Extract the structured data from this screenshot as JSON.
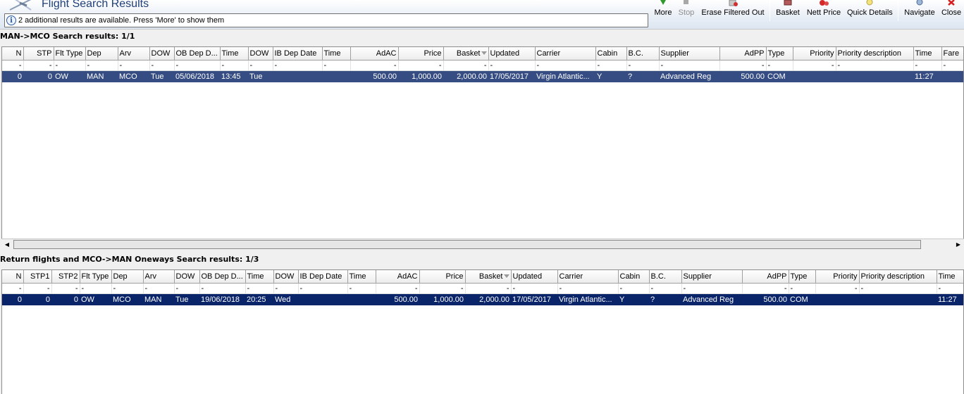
{
  "window": {
    "title": "Flight Search Results"
  },
  "info_bar": {
    "message": "2 additional results are available. Press 'More' to show them"
  },
  "toolbar": {
    "more": "More",
    "stop": "Stop",
    "erase_filtered_out": "Erase Filtered Out",
    "basket": "Basket",
    "nett_price": "Nett Price",
    "quick_details": "Quick Details",
    "navigate": "Navigate",
    "close": "Close"
  },
  "outbound": {
    "title": "MAN->MCO Search results: 1/1",
    "columns": [
      "N",
      "STP",
      "Flt Type",
      "Dep",
      "Arv",
      "DOW",
      "OB Dep D...",
      "Time",
      "DOW",
      "IB Dep Date",
      "Time",
      "AdAC",
      "Price",
      "Basket",
      "Updated",
      "Carrier",
      "Cabin",
      "B.C.",
      "Supplier",
      "AdPP",
      "Type",
      "Priority",
      "Priority description",
      "Time",
      "Fare"
    ],
    "filter_row": [
      "-",
      "-",
      "-",
      "-",
      "-",
      "-",
      "-",
      "-",
      "-",
      "-",
      "-",
      "-",
      "-",
      "-",
      "-",
      "-",
      "-",
      "-",
      "-",
      "-",
      "-",
      "-",
      "-",
      "-",
      "-"
    ],
    "rows": [
      [
        "0",
        "0",
        "OW",
        "MAN",
        "MCO",
        "Tue",
        "05/06/2018",
        "13:45",
        "Tue",
        "",
        "",
        "500.00",
        "1,000.00",
        "2,000.00",
        "17/05/2017",
        "Virgin Atlantic...",
        "Y",
        "?",
        "Advanced Reg",
        "500.00",
        "COM",
        "",
        "",
        "11:27",
        ""
      ]
    ]
  },
  "return": {
    "title": "Return flights and MCO->MAN Oneways Search results: 1/3",
    "columns": [
      "N",
      "STP1",
      "STP2",
      "Flt Type",
      "Dep",
      "Arv",
      "DOW",
      "OB Dep D...",
      "Time",
      "DOW",
      "IB Dep Date",
      "Time",
      "AdAC",
      "Price",
      "Basket",
      "Updated",
      "Carrier",
      "Cabin",
      "B.C.",
      "Supplier",
      "AdPP",
      "Type",
      "Priority",
      "Priority description",
      "Time"
    ],
    "filter_row": [
      "-",
      "-",
      "-",
      "-",
      "-",
      "-",
      "-",
      "-",
      "-",
      "-",
      "-",
      "-",
      "-",
      "-",
      "-",
      "-",
      "-",
      "-",
      "-",
      "-",
      "-",
      "-",
      "-",
      "-",
      "-"
    ],
    "rows": [
      [
        "0",
        "0",
        "0",
        "OW",
        "MCO",
        "MAN",
        "Tue",
        "19/06/2018",
        "20:25",
        "Wed",
        "",
        "",
        "500.00",
        "1,000.00",
        "2,000.00",
        "17/05/2017",
        "Virgin Atlantic...",
        "Y",
        "?",
        "Advanced Reg",
        "500.00",
        "COM",
        "",
        "",
        "11:27"
      ]
    ]
  },
  "colors": {
    "selected_row_top": "#354d82",
    "selected_row_bottom": "#0a246a",
    "title_text": "#1e3f7a"
  }
}
